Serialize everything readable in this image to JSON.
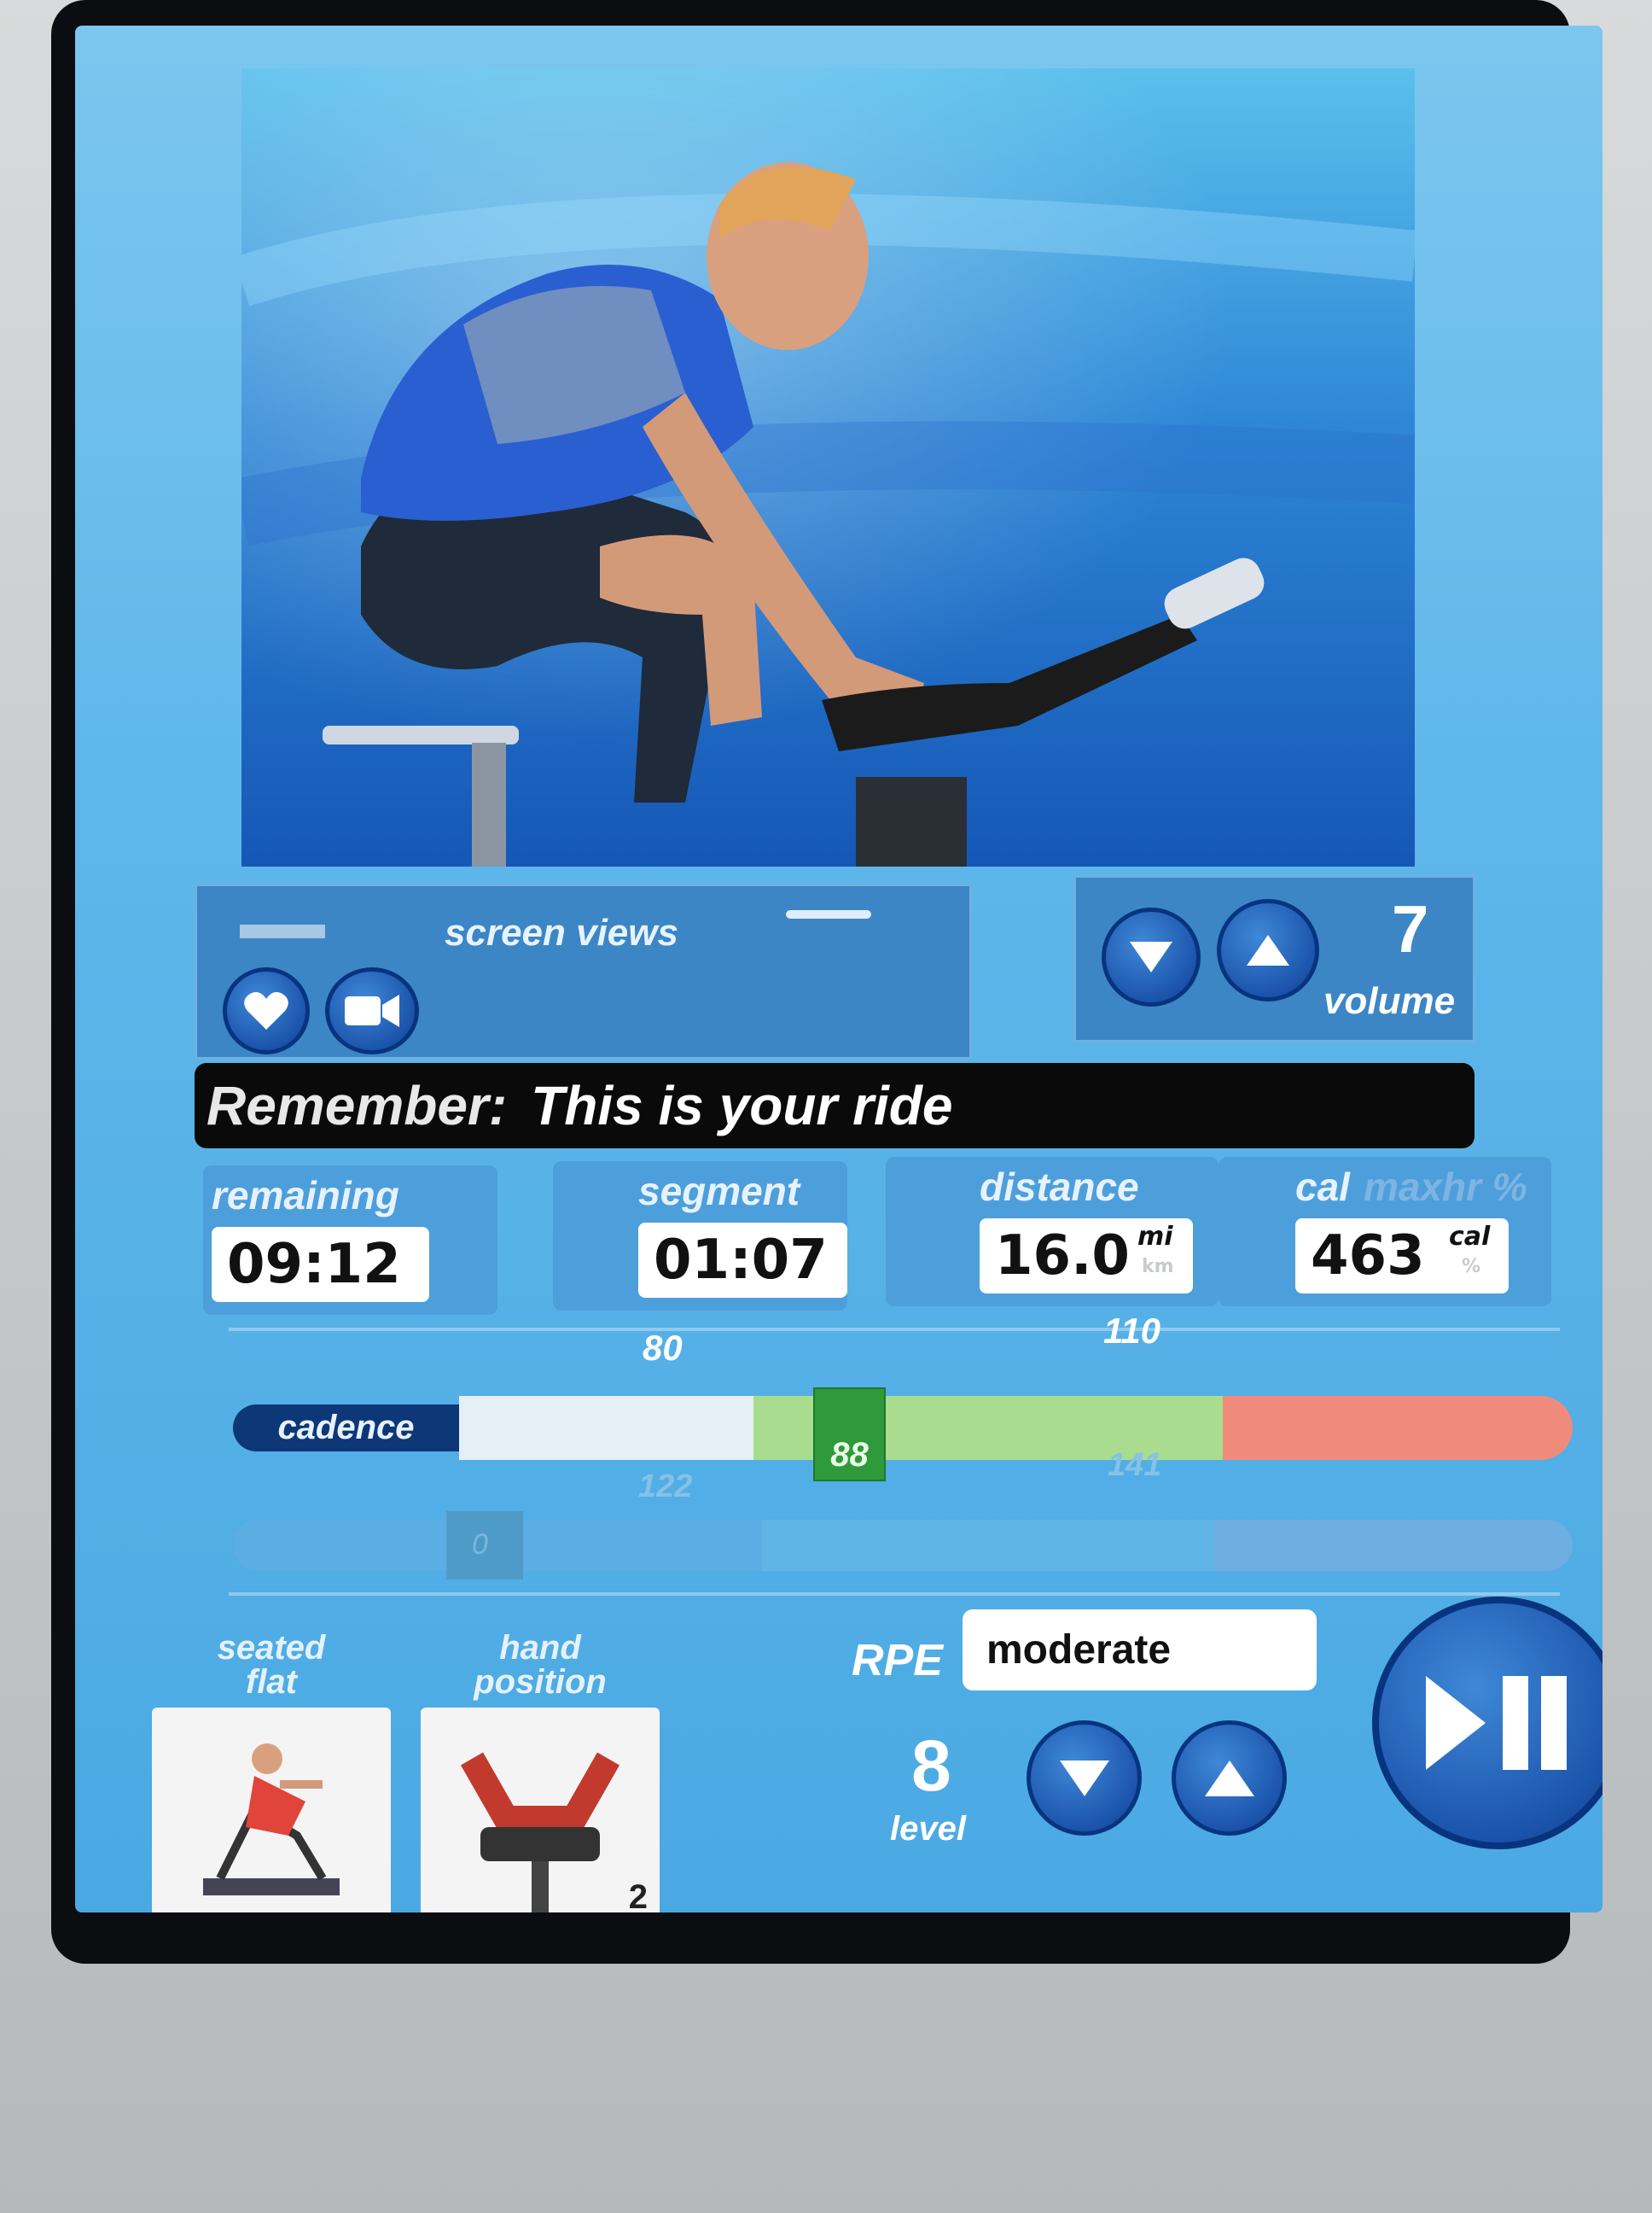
{
  "video": {
    "icon": "rider-video"
  },
  "screen_views": {
    "label": "screen views",
    "heart_icon": "heart-icon",
    "camera_icon": "video-camera-icon"
  },
  "volume": {
    "value": "7",
    "label": "volume"
  },
  "message": {
    "prefix": "Remember:",
    "text": "This is your ride"
  },
  "stats": {
    "remaining": {
      "label": "remaining",
      "value": "09:12"
    },
    "segment": {
      "label": "segment",
      "value": "01:07"
    },
    "distance": {
      "label": "distance",
      "value": "16.0",
      "unit": "mi",
      "unit_alt": "km"
    },
    "calories": {
      "label": "cal",
      "label_alt": "maxhr %",
      "value": "463",
      "unit": "cal",
      "unit_alt": "%"
    }
  },
  "cadence": {
    "label": "cadence",
    "zone_low": "80",
    "zone_high": "110",
    "current": "88",
    "faint_low": "122",
    "faint_high": "141"
  },
  "heart_rate_bar": {
    "marker": "0"
  },
  "position_card": {
    "title_line1": "seated",
    "title_line2": "flat"
  },
  "hand_card": {
    "title_line1": "hand",
    "title_line2": "position",
    "badge": "2"
  },
  "rpe": {
    "label": "RPE",
    "value": "moderate"
  },
  "level": {
    "value": "8",
    "label": "level"
  },
  "colors": {
    "screen": "#5fb7ea",
    "button": "#0d3f98",
    "cadence_good": "#a9dc8e",
    "cadence_high": "#f08b7b"
  }
}
